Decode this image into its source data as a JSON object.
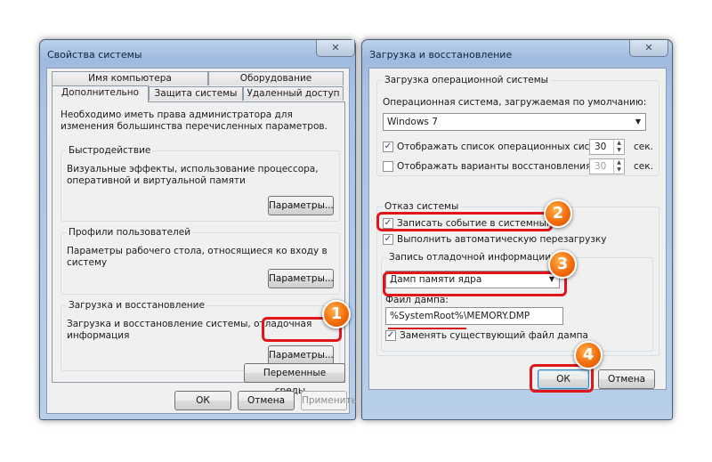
{
  "left_window": {
    "title": "Свойства системы",
    "close_glyph": "✕",
    "tabs_top": [
      "Имя компьютера",
      "Оборудование"
    ],
    "tabs_bottom": [
      "Дополнительно",
      "Защита системы",
      "Удаленный доступ"
    ],
    "admin_note": "Необходимо иметь права администратора для изменения большинства перечисленных параметров.",
    "performance": {
      "title": "Быстродействие",
      "desc": "Визуальные эффекты, использование процессора, оперативной и виртуальной памяти",
      "button": "Параметры..."
    },
    "profiles": {
      "title": "Профили пользователей",
      "desc": "Параметры рабочего стола, относящиеся ко входу в систему",
      "button": "Параметры..."
    },
    "startup": {
      "title": "Загрузка и восстановление",
      "desc": "Загрузка и восстановление системы, отладочная информация",
      "button": "Параметры..."
    },
    "env_button": "Переменные среды...",
    "ok": "ОК",
    "cancel": "Отмена",
    "apply": "Применить"
  },
  "right_window": {
    "title": "Загрузка и восстановление",
    "close_glyph": "✕",
    "boot_group": {
      "title": "Загрузка операционной системы",
      "default_os_label": "Операционная система, загружаемая по умолчанию:",
      "default_os_value": "Windows 7",
      "show_list_label": "Отображать список операционных систем:",
      "show_list_checked": true,
      "show_list_value": "30",
      "show_recovery_label": "Отображать варианты восстановления:",
      "show_recovery_checked": false,
      "show_recovery_value": "30",
      "unit": "сек."
    },
    "failure_group": {
      "title": "Отказ системы",
      "write_event_label": "Записать событие в системный журнал",
      "write_event_checked": true,
      "auto_restart_label": "Выполнить автоматическую перезагрузку",
      "auto_restart_checked": true,
      "debug_title": "Запись отладочной информации",
      "debug_value": "Дамп памяти ядра",
      "dump_file_label": "Файл дампа:",
      "dump_file_value": "%SystemRoot%\\MEMORY.DMP",
      "overwrite_label": "Заменять существующий файл дампа",
      "overwrite_checked": true
    },
    "ok": "ОК",
    "cancel": "Отмена"
  },
  "markers": [
    "1",
    "2",
    "3",
    "4"
  ],
  "colors": {
    "highlight": "#e0161b",
    "badge": "#f36d0a",
    "title_bar": "#a9c3e5"
  }
}
